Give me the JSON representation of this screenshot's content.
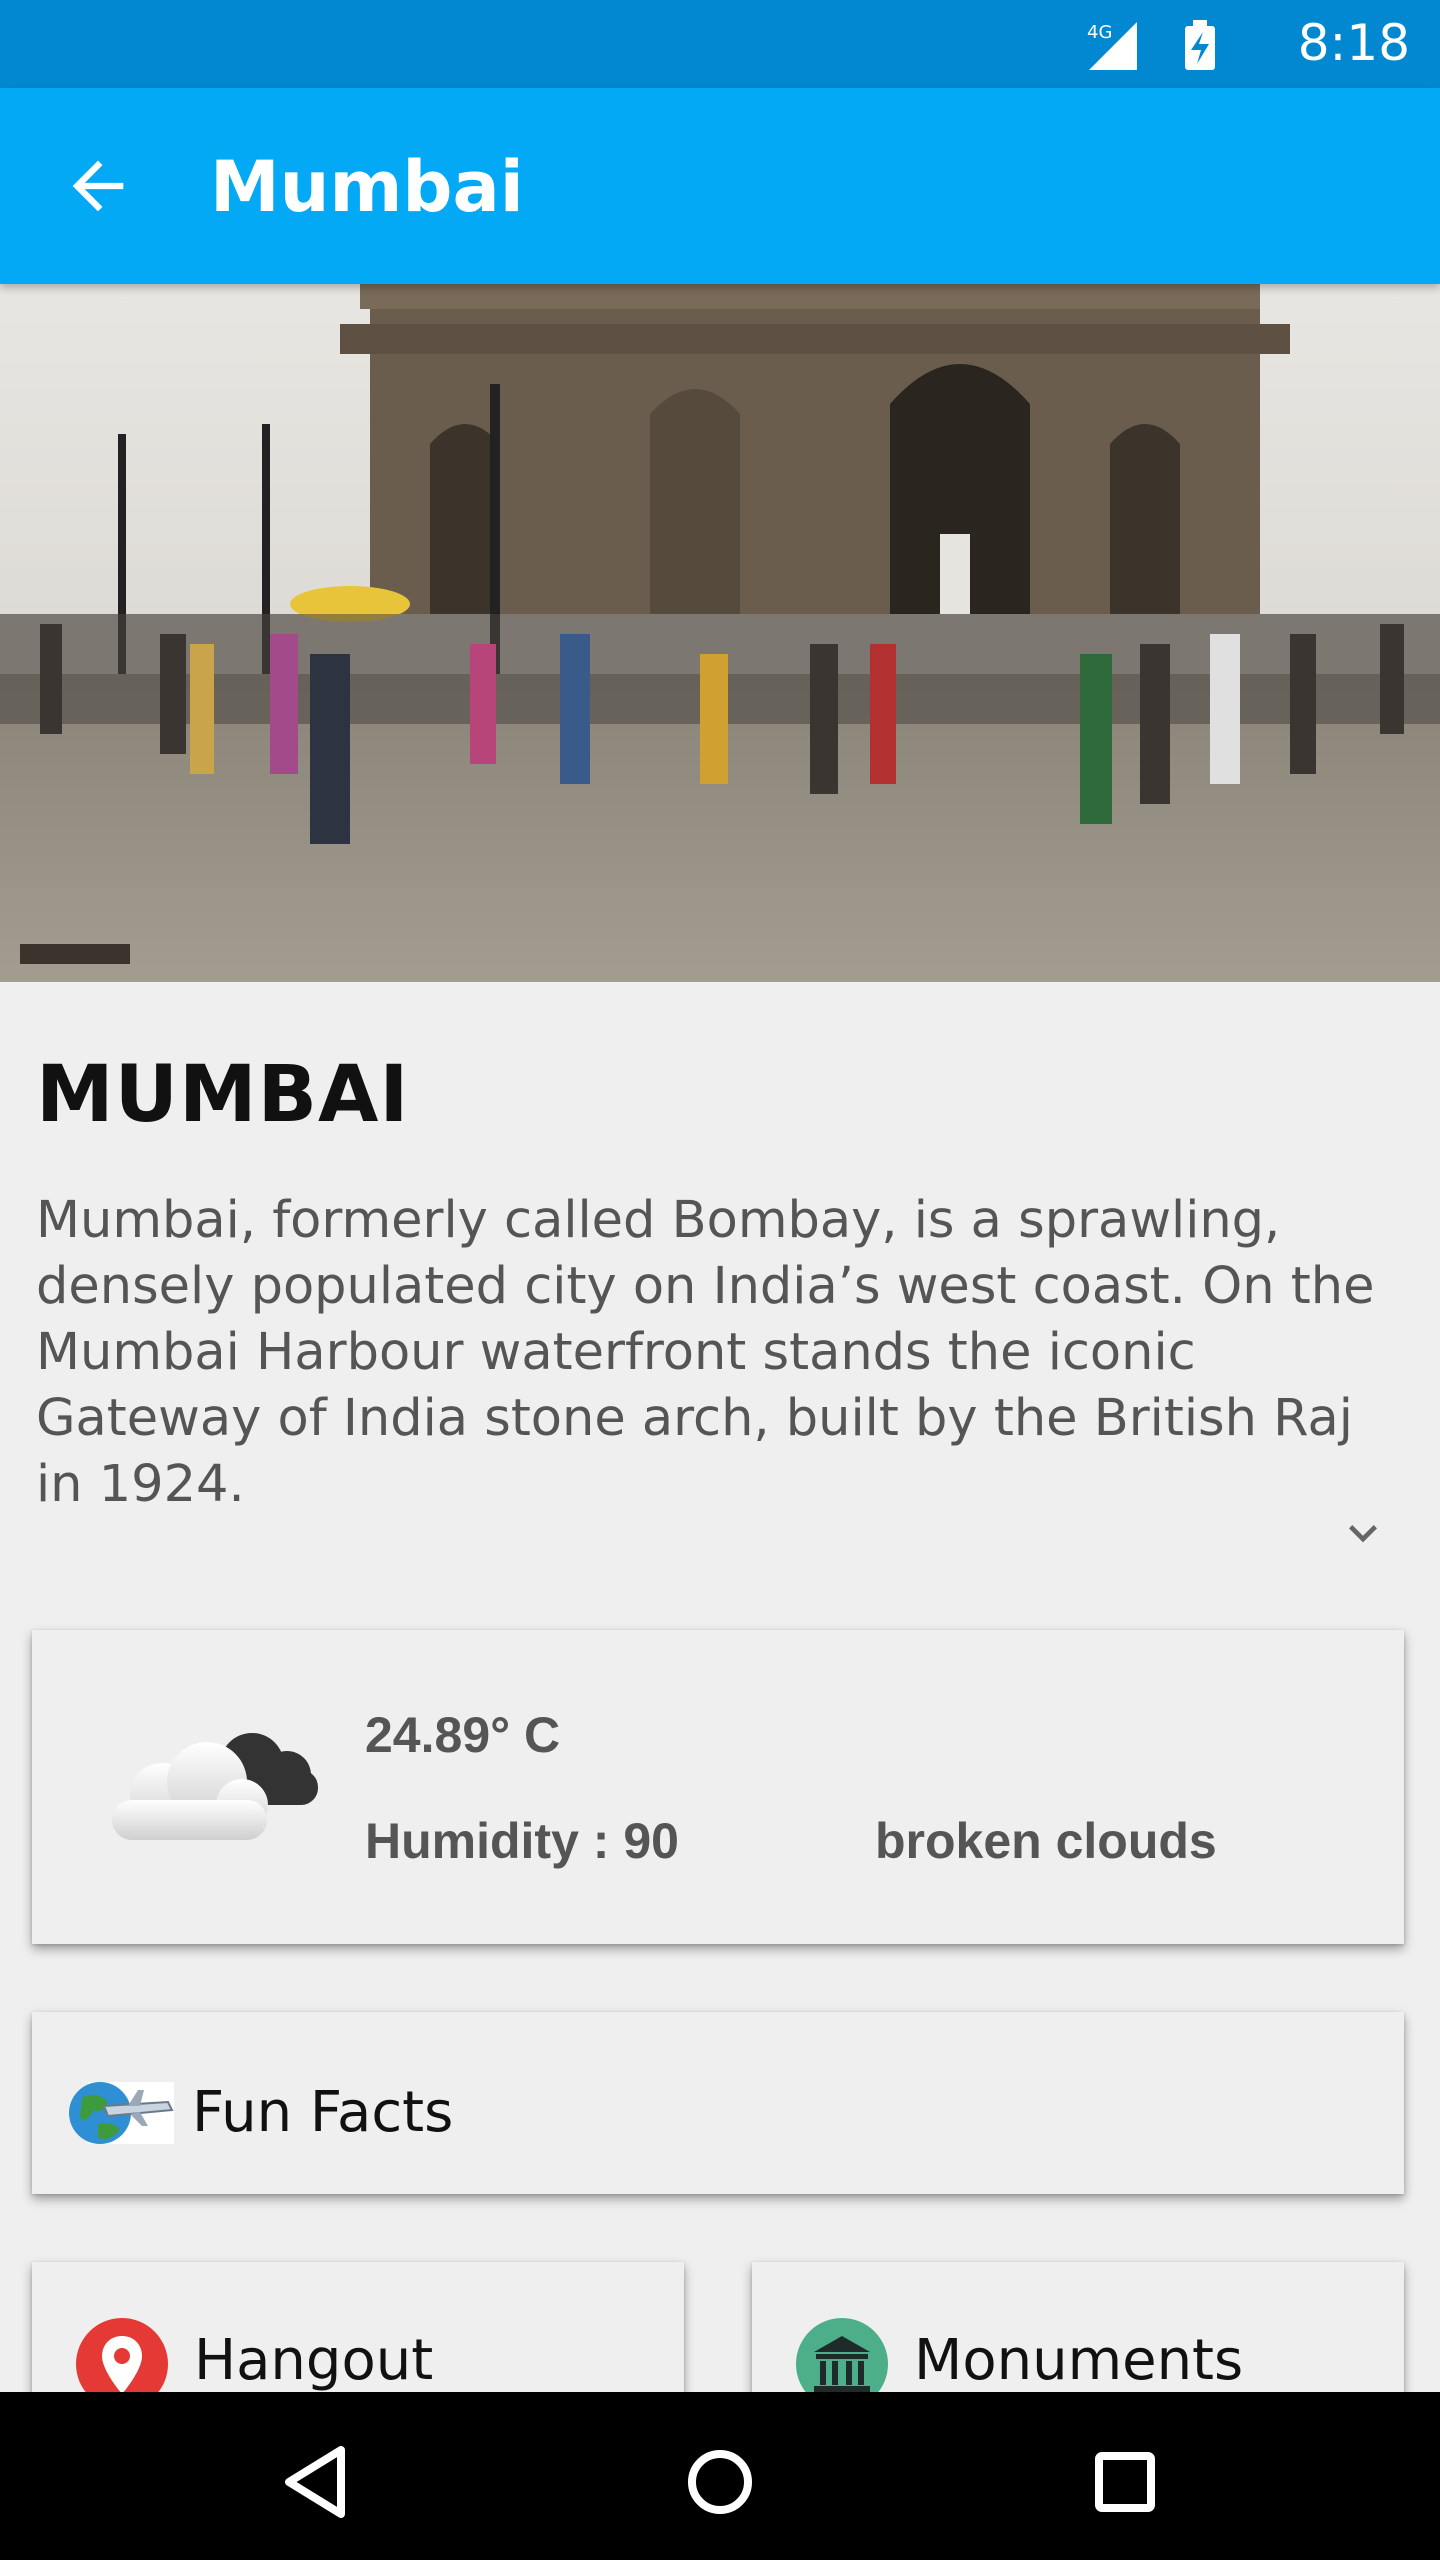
{
  "status_bar": {
    "network": "4G",
    "time": "8:18"
  },
  "app_bar": {
    "title": "Mumbai"
  },
  "city": {
    "heading": "MUMBAI",
    "description": "Mumbai, formerly called Bombay, is a sprawling, densely populated city on India’s west coast. On the Mumbai Harbour waterfront stands the iconic Gateway of India stone arch, built by the British Raj in 1924."
  },
  "weather": {
    "temperature": "24.89° C",
    "humidity": "Humidity : 90",
    "condition": "broken clouds",
    "icon": "cloud-icon"
  },
  "tiles": {
    "fun_facts": {
      "label": "Fun Facts",
      "icon": "globe-plane-icon"
    },
    "hangout": {
      "label": "Hangout",
      "icon": "map-pin-icon"
    },
    "monuments": {
      "label": "Monuments",
      "icon": "monument-icon"
    }
  },
  "colors": {
    "status_bar": "#0288d1",
    "app_bar": "#03a9f4",
    "background": "#efefef",
    "nav_bar": "#000000"
  }
}
